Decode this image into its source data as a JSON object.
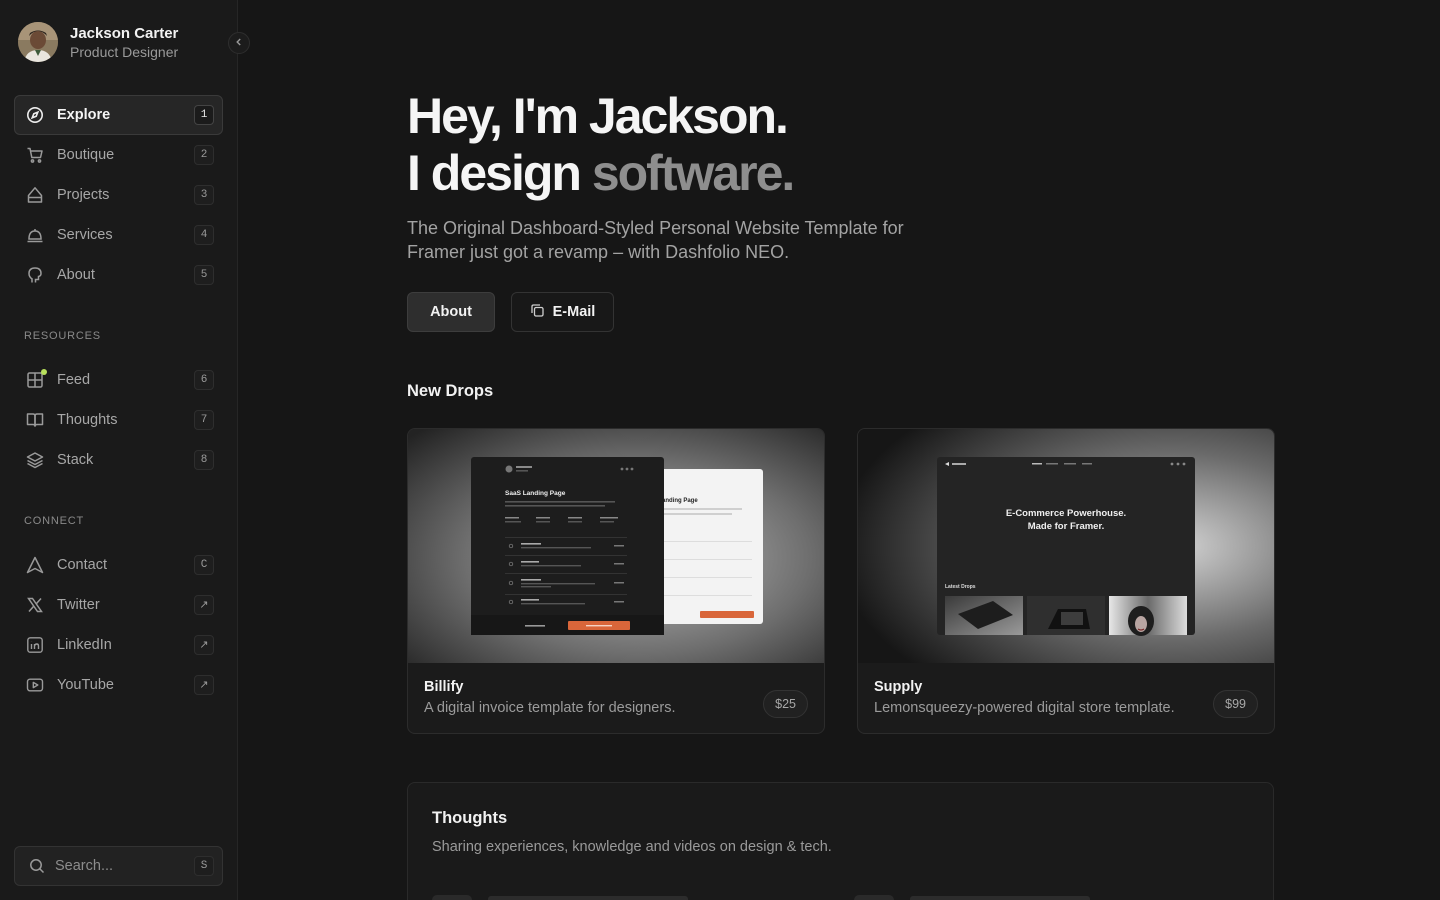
{
  "profile": {
    "name": "Jackson Carter",
    "role": "Product Designer"
  },
  "nav": [
    {
      "label": "Explore",
      "key": "1",
      "icon": "compass-icon"
    },
    {
      "label": "Boutique",
      "key": "2",
      "icon": "cart-icon"
    },
    {
      "label": "Projects",
      "key": "3",
      "icon": "shape-icon"
    },
    {
      "label": "Services",
      "key": "4",
      "icon": "cloche-icon"
    },
    {
      "label": "About",
      "key": "5",
      "icon": "head-icon"
    }
  ],
  "resources": {
    "title": "RESOURCES",
    "items": [
      {
        "label": "Feed",
        "key": "6",
        "icon": "feed-icon"
      },
      {
        "label": "Thoughts",
        "key": "7",
        "icon": "book-icon"
      },
      {
        "label": "Stack",
        "key": "8",
        "icon": "layers-icon"
      }
    ]
  },
  "connect": {
    "title": "CONNECT",
    "items": [
      {
        "label": "Contact",
        "key": "C",
        "icon": "send-icon"
      },
      {
        "label": "Twitter",
        "key": "↗",
        "icon": "x-icon"
      },
      {
        "label": "LinkedIn",
        "key": "↗",
        "icon": "linkedin-icon"
      },
      {
        "label": "YouTube",
        "key": "↗",
        "icon": "youtube-icon"
      }
    ]
  },
  "search": {
    "placeholder": "Search...",
    "key": "S"
  },
  "hero": {
    "line1": "Hey, I'm Jackson.",
    "line2_prefix": "I design ",
    "line2_highlight": "software.",
    "subtitle": "The Original Dashboard-Styled Personal Website Template for Framer just got a revamp – with Dashfolio NEO."
  },
  "buttons": {
    "about": "About",
    "email": "E-Mail"
  },
  "new_drops": {
    "title": "New Drops",
    "items": [
      {
        "title": "Billify",
        "description": "A digital invoice template for designers.",
        "price": "$25",
        "preview_title": "SaaS Landing Page",
        "preview_title_light": "anding Page"
      },
      {
        "title": "Supply",
        "description": "Lemonsqueezy-powered digital store template.",
        "price": "$99",
        "preview_heading": "E-Commerce Powerhouse.\nMade for Framer.",
        "preview_section": "Latest Drops"
      }
    ]
  },
  "thoughts": {
    "title": "Thoughts",
    "subtitle": "Sharing experiences, knowledge and videos on design & tech."
  },
  "colors": {
    "background": "#161616",
    "sidebar": "#1a1a1a",
    "accent_orange": "#d9663a",
    "online_dot": "#b8e05c"
  }
}
